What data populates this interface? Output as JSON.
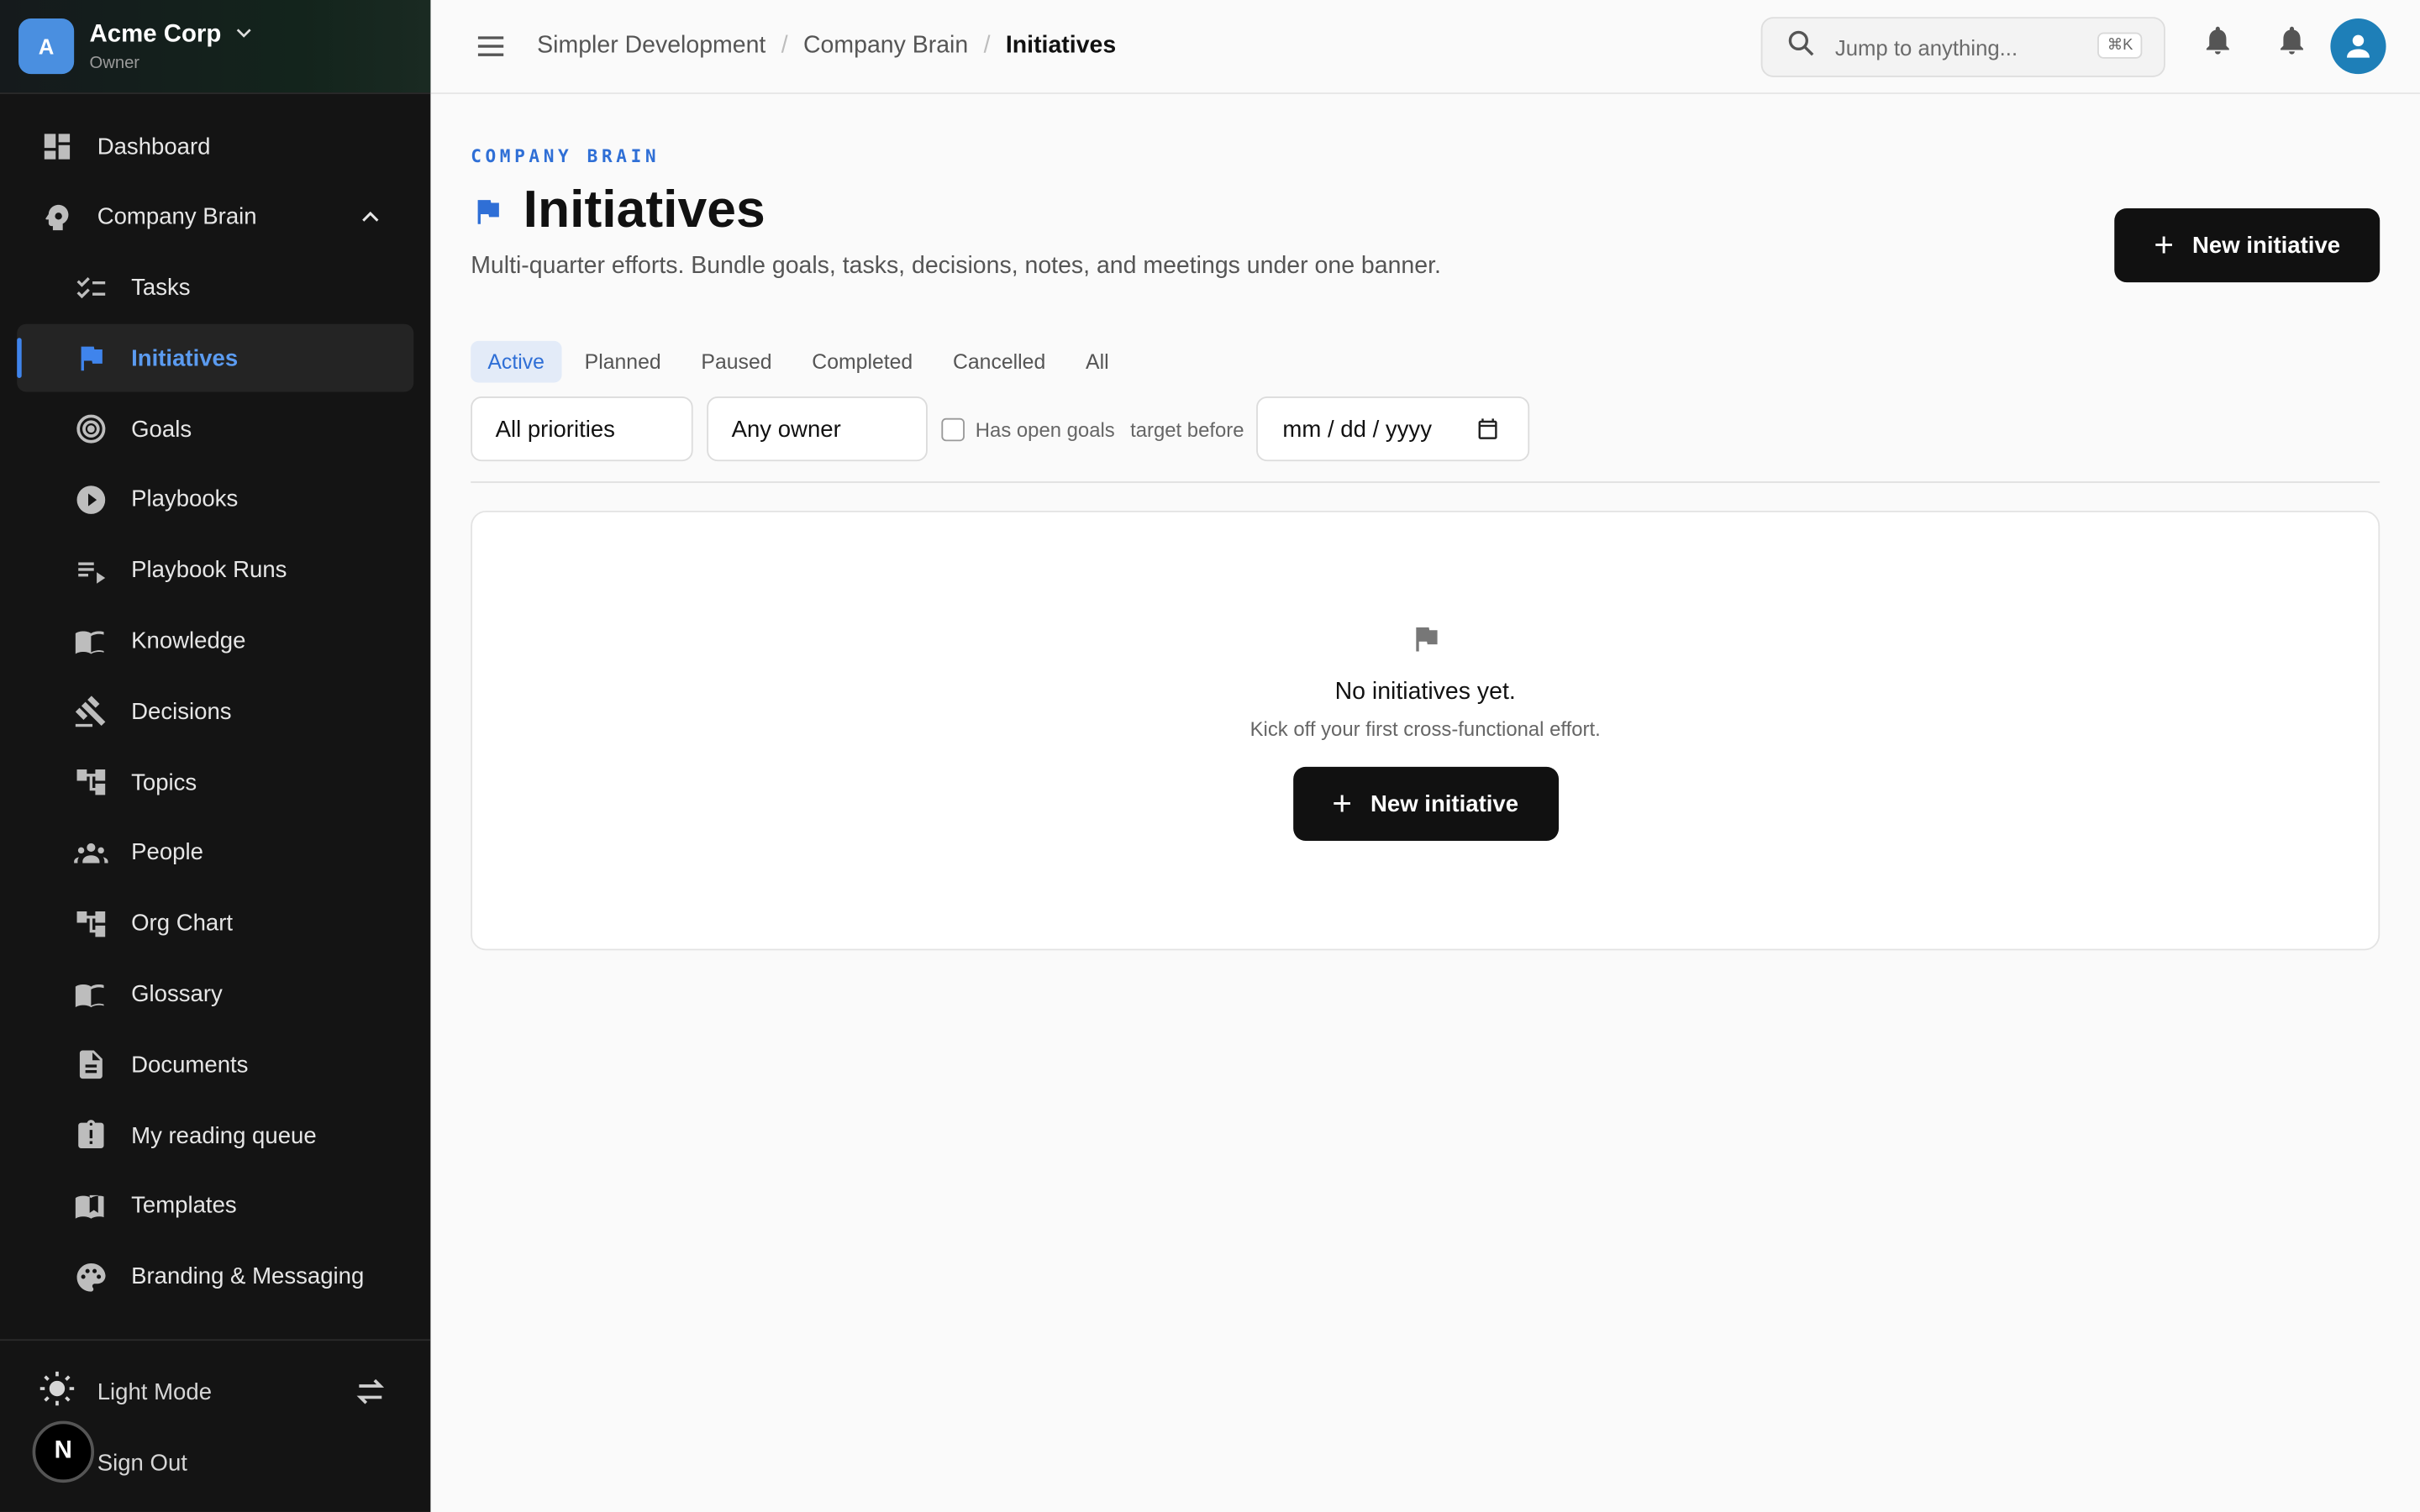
{
  "org": {
    "initial": "A",
    "name": "Acme Corp",
    "role": "Owner"
  },
  "sidebar": {
    "items": [
      {
        "label": "Dashboard",
        "icon": "dashboard-icon"
      },
      {
        "label": "Company Brain",
        "icon": "brain-icon"
      },
      {
        "label": "Tasks",
        "icon": "checklist-icon"
      },
      {
        "label": "Initiatives",
        "icon": "flag-icon"
      },
      {
        "label": "Goals",
        "icon": "target-icon"
      },
      {
        "label": "Playbooks",
        "icon": "play-icon"
      },
      {
        "label": "Playbook Runs",
        "icon": "playlist-icon"
      },
      {
        "label": "Knowledge",
        "icon": "book-icon"
      },
      {
        "label": "Decisions",
        "icon": "gavel-icon"
      },
      {
        "label": "Topics",
        "icon": "hierarchy-icon"
      },
      {
        "label": "People",
        "icon": "people-icon"
      },
      {
        "label": "Org Chart",
        "icon": "hierarchy-icon"
      },
      {
        "label": "Glossary",
        "icon": "book-icon"
      },
      {
        "label": "Documents",
        "icon": "document-icon"
      },
      {
        "label": "My reading queue",
        "icon": "clipboard-alert-icon"
      },
      {
        "label": "Templates",
        "icon": "book-open-icon"
      },
      {
        "label": "Branding & Messaging",
        "icon": "palette-icon"
      }
    ],
    "bottom": {
      "theme_label": "Light Mode",
      "signout_label": "Sign Out",
      "badge": "N"
    }
  },
  "topbar": {
    "breadcrumbs": [
      "Simpler Development",
      "Company Brain",
      "Initiatives"
    ],
    "search_placeholder": "Jump to anything...",
    "search_shortcut": "⌘K"
  },
  "page": {
    "eyebrow": "COMPANY BRAIN",
    "title": "Initiatives",
    "subtitle": "Multi-quarter efforts. Bundle goals, tasks, decisions, notes, and meetings under one banner.",
    "new_button": "New initiative",
    "tabs": [
      "Active",
      "Planned",
      "Paused",
      "Completed",
      "Cancelled",
      "All"
    ],
    "active_tab": "Active",
    "filters": {
      "priority": "All priorities",
      "owner": "Any owner",
      "open_goals_label": "Has open goals",
      "target_label": "target before",
      "date_placeholder": "mm / dd / yyyy"
    },
    "empty": {
      "title": "No initiatives yet.",
      "subtitle": "Kick off your first cross-functional effort.",
      "button": "New initiative"
    }
  },
  "colors": {
    "accent": "#2f6fd6",
    "sidebar_bg": "#141414",
    "button_bg": "#111111"
  }
}
